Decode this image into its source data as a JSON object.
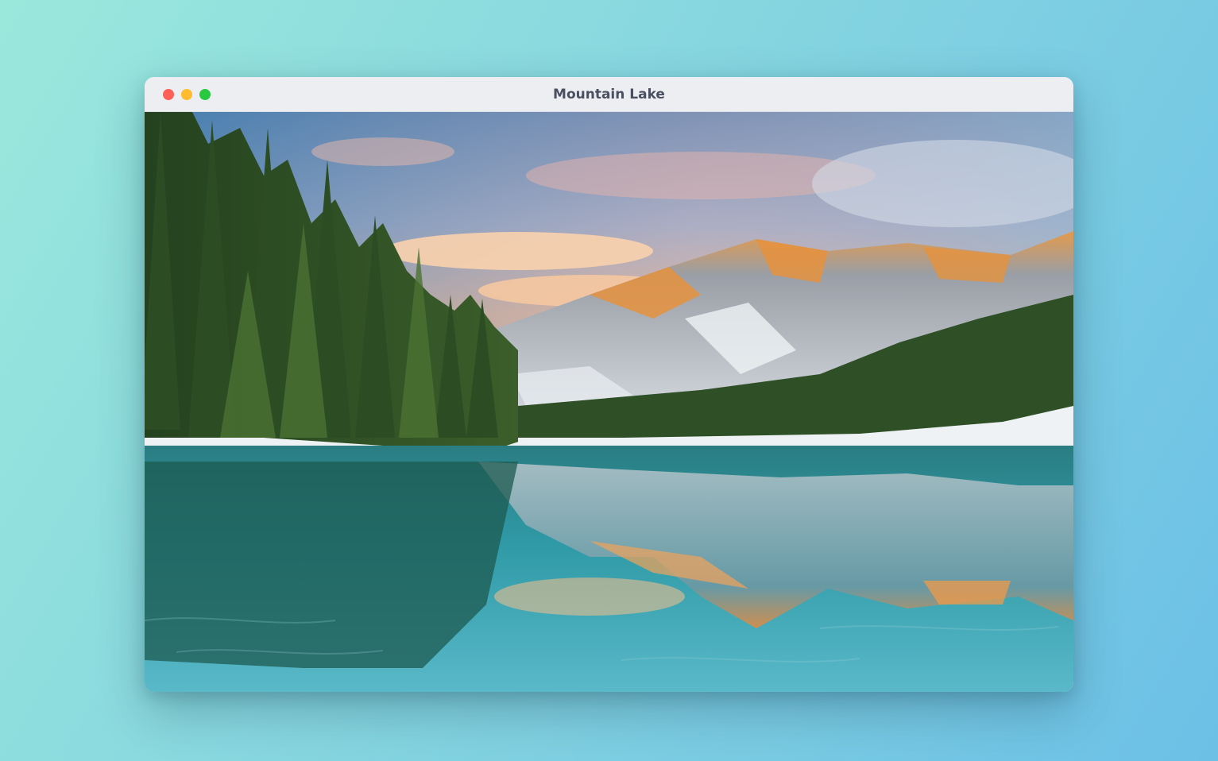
{
  "window": {
    "title": "Mountain Lake",
    "controls": {
      "close_color": "#ff5f57",
      "minimize_color": "#febc2e",
      "maximize_color": "#28c840"
    }
  },
  "image": {
    "subject": "landscape-photo"
  },
  "colors": {
    "background_start": "#9ae8dc",
    "background_end": "#6cc0e6",
    "titlebar": "#eceef2",
    "title_text": "#4a5060"
  }
}
